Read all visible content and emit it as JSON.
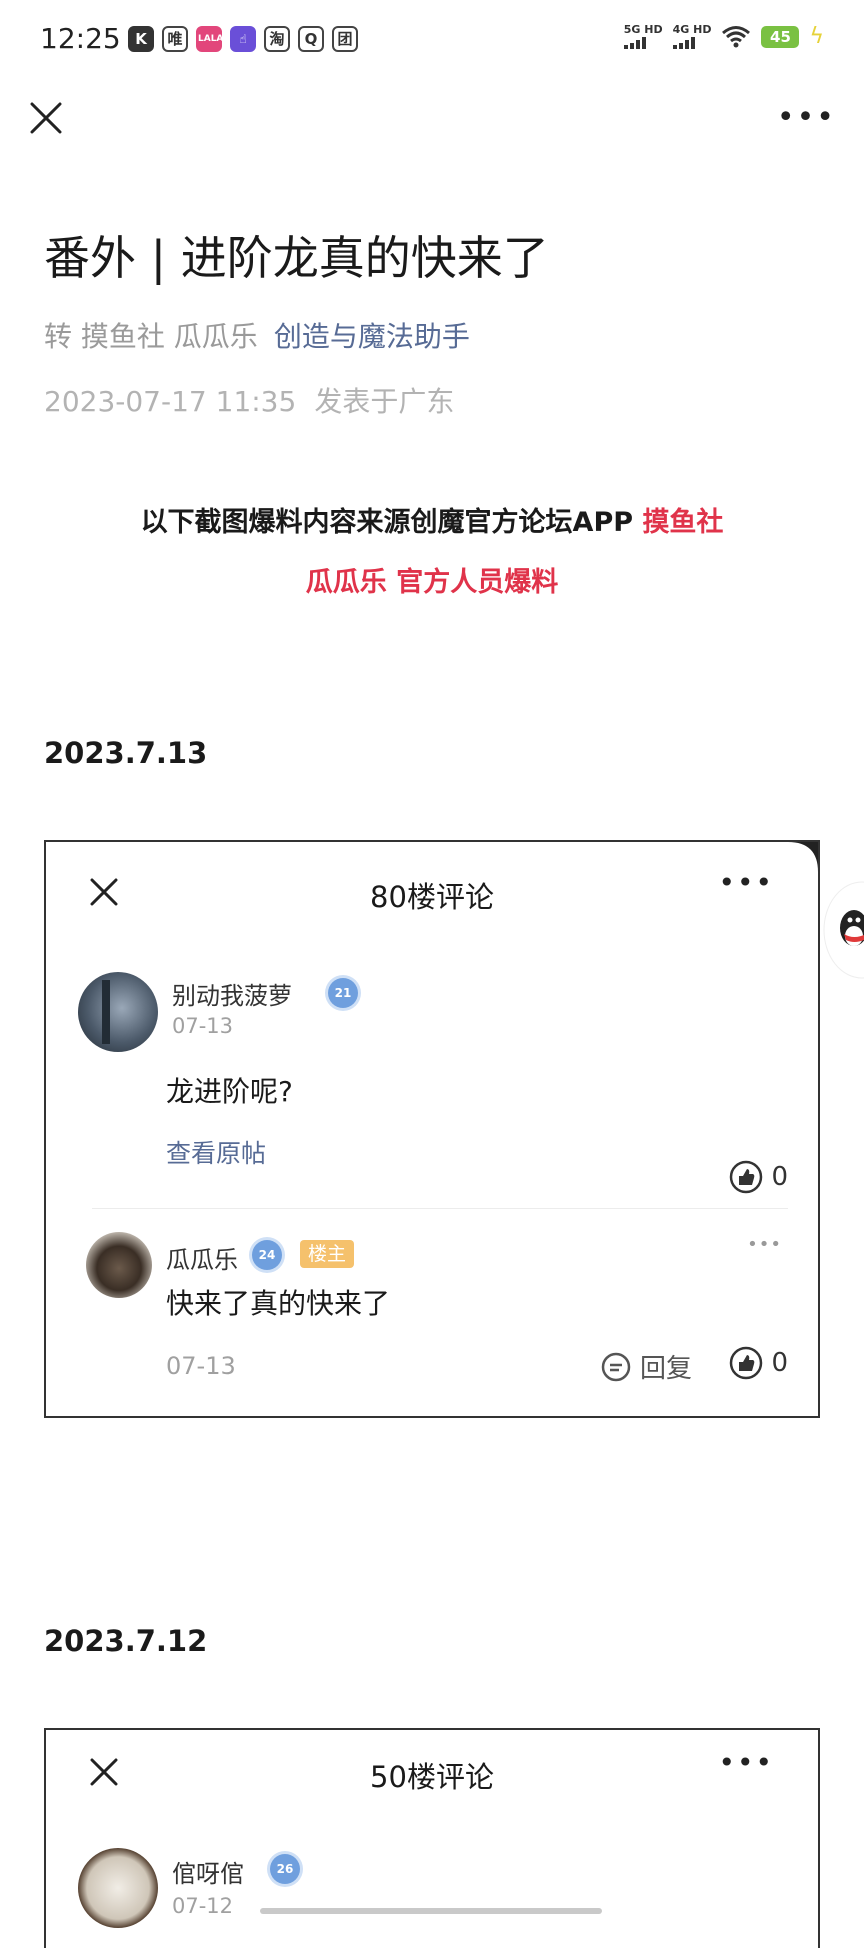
{
  "status_bar": {
    "time": "12:25",
    "app_icons": [
      "K",
      "唯",
      "LALA",
      "☝",
      "淘",
      "团",
      "团"
    ],
    "network_1": "5G HD",
    "network_2": "4G HD",
    "battery": "45"
  },
  "nav": {
    "close_icon": "close-icon",
    "more_icon": "more-dots-icon"
  },
  "article": {
    "title": "番外 | 进阶龙真的快来了",
    "repost_label": "转 摸鱼社 瓜瓜乐",
    "account_name": "创造与魔法助手",
    "publish_time": "2023-07-17 11:35",
    "location": "发表于广东",
    "intro_line1_black": "以下截图爆料内容来源创魔官方论坛APP ",
    "intro_line1_red": "摸鱼社",
    "intro_line2_red": "瓜瓜乐 官方人员爆料"
  },
  "sections": [
    {
      "date": "2023.7.13",
      "card_title": "80楼评论",
      "comment": {
        "user": "别动我菠萝",
        "level": "21",
        "date": "07-13",
        "text": "龙进阶呢?",
        "link": "查看原帖",
        "likes": "0"
      },
      "reply": {
        "user": "瓜瓜乐",
        "level": "24",
        "tag": "楼主",
        "text": "快来了真的快来了",
        "date": "07-13",
        "reply_label": "回复",
        "likes": "0"
      }
    },
    {
      "date": "2023.7.12",
      "card_title": "50楼评论",
      "comment": {
        "user": "倌呀倌",
        "level": "26",
        "date": "07-12"
      }
    }
  ],
  "colors": {
    "accent_red": "#e0334a",
    "link_blue": "#576b95",
    "level_blue": "#6f9fde",
    "host_tag": "#f5c16c"
  }
}
